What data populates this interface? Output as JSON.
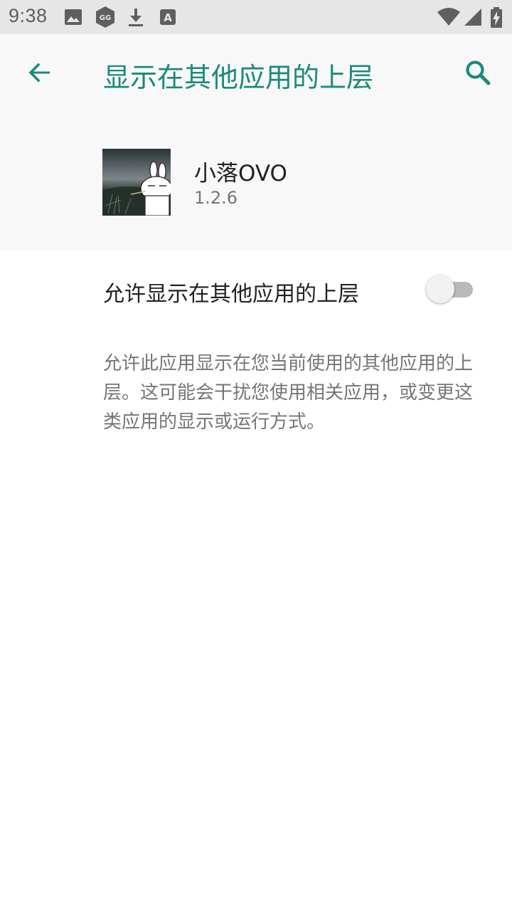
{
  "status_bar": {
    "time": "9:38",
    "left_icons": [
      "image-icon",
      "gg-shield-icon",
      "download-icon",
      "a-box-icon"
    ],
    "right_icons": [
      "wifi-icon",
      "cell-signal-icon",
      "battery-charging-icon"
    ]
  },
  "header": {
    "title": "显示在其他应用的上层",
    "back_icon": "arrow-back-icon",
    "search_icon": "search-icon",
    "accent_color": "#1a8a7c"
  },
  "app": {
    "name": "小落OVO",
    "version": "1.2.6"
  },
  "permission": {
    "label": "允许显示在其他应用的上层",
    "enabled": false,
    "description": "允许此应用显示在您当前使用的其他应用的上层。这可能会干扰您使用相关应用，或变更这类应用的显示或运行方式。"
  }
}
